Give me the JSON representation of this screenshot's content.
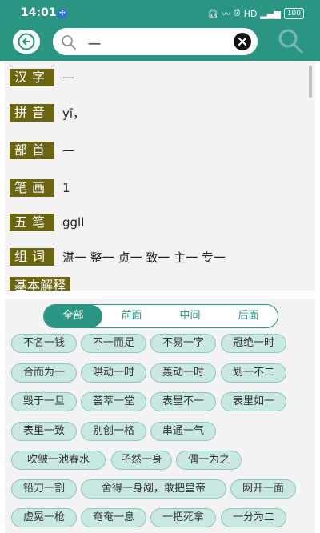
{
  "status_bar": {
    "time": "14:01",
    "network_label": "HD",
    "battery": "100"
  },
  "search": {
    "query": "一"
  },
  "entry": {
    "hanzi": {
      "label": "汉字",
      "value": "一"
    },
    "pinyin": {
      "label": "拼音",
      "value": "yī，"
    },
    "radical": {
      "label": "部首",
      "value": "一"
    },
    "strokes": {
      "label": "笔画",
      "value": "1"
    },
    "wubi": {
      "label": "五笔",
      "value": "ggll"
    },
    "words": {
      "label": "组词",
      "value": "湛一 整一 贞一 致一 主一 专一"
    },
    "basic": {
      "label": "基本解释"
    }
  },
  "tabs": [
    "全部",
    "前面",
    "中间",
    "后面"
  ],
  "active_tab": "全部",
  "idioms": [
    "不名一钱",
    "不一而足",
    "不易一字",
    "冠绝一时",
    "合而为一",
    "哄动一时",
    "轰动一时",
    "划一不二",
    "毁于一旦",
    "荟萃一堂",
    "表里不一",
    "表里如一",
    "表里一致",
    "别创一格",
    "串通一气",
    "吹皱一池春水",
    "孑然一身",
    "偶一为之",
    "铅刀一割",
    "舍得一身剐，敢把皇帝",
    "网开一面",
    "虚晃一枪",
    "奄奄一息",
    "一把死拿",
    "一分为二"
  ],
  "colors": {
    "primary": "#2b9584",
    "tag": "#6b6411",
    "chip_bg": "#c8e8e1",
    "chip_border": "#8ec7bc"
  },
  "icons": [
    "back-arrow-icon",
    "search-icon",
    "clear-icon",
    "search-icon-right"
  ]
}
